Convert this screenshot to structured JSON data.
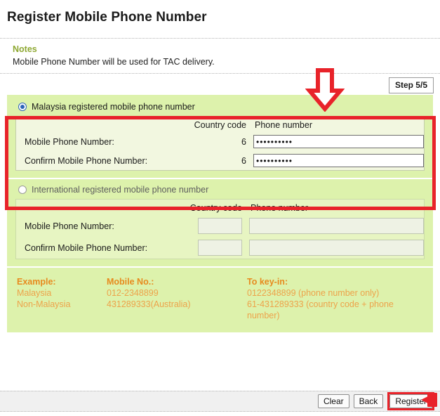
{
  "page_title": "Register Mobile Phone Number",
  "notes": {
    "title": "Notes",
    "text": "Mobile Phone Number will be used for TAC delivery."
  },
  "step_badge": "Step 5/5",
  "colors": {
    "highlight_red": "#e8232a",
    "panel_green": "#ddf2ac",
    "inner_panel": "#f2f7e0",
    "notes_title": "#8ea832",
    "example_heading": "#e78a1e",
    "example_text": "#eda34a",
    "radio_selected": "#2a62b8"
  },
  "options": {
    "malaysia": {
      "label": "Malaysia registered mobile phone number",
      "selected": true,
      "headers": {
        "country_code": "Country code",
        "phone_number": "Phone number"
      },
      "rows": [
        {
          "label": "Mobile Phone Number:",
          "country_code": "6",
          "phone_value": "••••••••••",
          "phone_placeholder": ""
        },
        {
          "label": "Confirm Mobile Phone Number:",
          "country_code": "6",
          "phone_value": "••••••••••",
          "phone_placeholder": ""
        }
      ]
    },
    "international": {
      "label": "International registered mobile phone number",
      "selected": false,
      "disabled": true,
      "headers": {
        "country_code": "Country code",
        "phone_number": "Phone number"
      },
      "rows": [
        {
          "label": "Mobile Phone Number:",
          "country_code": "",
          "phone_value": "",
          "phone_placeholder": ""
        },
        {
          "label": "Confirm Mobile Phone Number:",
          "country_code": "",
          "phone_value": "",
          "phone_placeholder": ""
        }
      ]
    }
  },
  "example": {
    "col1": {
      "heading": "Example:",
      "line1": "Malaysia",
      "line2": "Non-Malaysia"
    },
    "col2": {
      "heading": "Mobile No.:",
      "line1": "012-2348899",
      "line2": "431289333(Australia)"
    },
    "col3": {
      "heading": "To key-in:",
      "line1": "0122348899 (phone number only)",
      "line2": "61-431289333 (country code + phone number)"
    }
  },
  "footer": {
    "clear_label": "Clear",
    "back_label": "Back",
    "register_label": "Register"
  },
  "annotations": {
    "down_arrow": "red-down-arrow",
    "left_arrow": "red-left-arrow",
    "malaysia_highlight": "red-rectangle-highlight"
  }
}
